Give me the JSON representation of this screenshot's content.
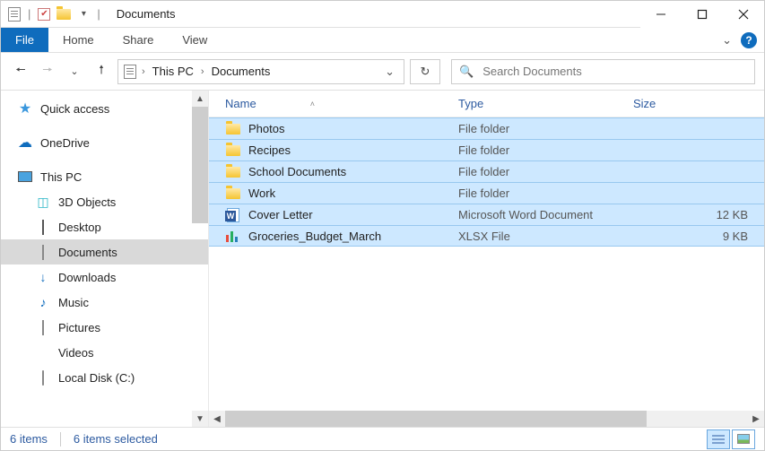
{
  "window": {
    "title": "Documents"
  },
  "ribbon": {
    "file": "File",
    "tabs": [
      "Home",
      "Share",
      "View"
    ]
  },
  "breadcrumb": {
    "items": [
      "This PC",
      "Documents"
    ]
  },
  "search": {
    "placeholder": "Search Documents"
  },
  "sidebar": {
    "quick_access": "Quick access",
    "onedrive": "OneDrive",
    "this_pc": "This PC",
    "children": [
      {
        "label": "3D Objects",
        "icon": "cube"
      },
      {
        "label": "Desktop",
        "icon": "monitor"
      },
      {
        "label": "Documents",
        "icon": "page",
        "selected": true
      },
      {
        "label": "Downloads",
        "icon": "down"
      },
      {
        "label": "Music",
        "icon": "note"
      },
      {
        "label": "Pictures",
        "icon": "pic"
      },
      {
        "label": "Videos",
        "icon": "film"
      },
      {
        "label": "Local Disk (C:)",
        "icon": "disk"
      }
    ]
  },
  "columns": {
    "name": "Name",
    "type": "Type",
    "size": "Size"
  },
  "rows": [
    {
      "name": "Photos",
      "type": "File folder",
      "size": "",
      "icon": "folder"
    },
    {
      "name": "Recipes",
      "type": "File folder",
      "size": "",
      "icon": "folder"
    },
    {
      "name": "School Documents",
      "type": "File folder",
      "size": "",
      "icon": "folder"
    },
    {
      "name": "Work",
      "type": "File folder",
      "size": "",
      "icon": "folder"
    },
    {
      "name": "Cover Letter",
      "type": "Microsoft Word Document",
      "size": "12 KB",
      "icon": "word"
    },
    {
      "name": "Groceries_Budget_March",
      "type": "XLSX File",
      "size": "9 KB",
      "icon": "chart"
    }
  ],
  "status": {
    "count": "6 items",
    "selected": "6 items selected"
  }
}
